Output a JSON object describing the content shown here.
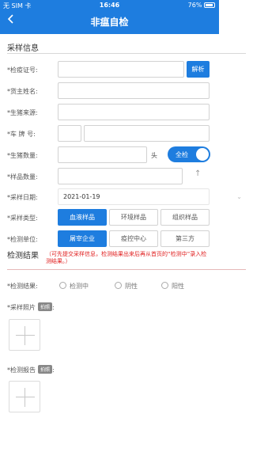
{
  "status_bar": {
    "carrier": "无 SIM 卡",
    "time": "16:46",
    "battery": "76%"
  },
  "header": {
    "title": "非瘟自检",
    "back_icon": "chevron-left-icon"
  },
  "sampling": {
    "section_title": "采样信息",
    "fields": {
      "quarantine_cert": {
        "label": "*检疫证号:",
        "value": "",
        "button": "解析"
      },
      "owner_name": {
        "label": "*货主姓名:",
        "value": ""
      },
      "pig_source": {
        "label": "*生猪来源:",
        "value": ""
      },
      "plate": {
        "label": "*车  牌  号:",
        "prefix": "",
        "value": ""
      },
      "pig_count": {
        "label": "*生猪数量:",
        "value": "",
        "unit": "头",
        "toggle_label": "全检",
        "toggle_on": true
      },
      "sample_count": {
        "label": "*样品数量:",
        "value": "",
        "arrow_icon": "arrow-up-icon"
      },
      "sample_date": {
        "label": "*采样日期:",
        "value": "2021-01-19",
        "dropdown_icon": "chevron-down-icon"
      },
      "sample_type": {
        "label": "*采样类型:",
        "options": [
          "血液样品",
          "环境样品",
          "组织样品"
        ],
        "selected": 0
      },
      "test_unit": {
        "label": "*检测单位:",
        "options": [
          "屠宰企业",
          "疫控中心",
          "第三方"
        ],
        "selected": 0
      }
    }
  },
  "result": {
    "section_title": "检测结果",
    "note": "（可先提交采样信息，检测结果出来后再从首页的“检测中”录入检测结果。）",
    "label": "*检测结果:",
    "options": [
      "检测中",
      "阴性",
      "阳性"
    ],
    "photo_label": "*采样照片",
    "photo_tag": "拍照",
    "report_label": "*检测报告",
    "report_tag": "拍照",
    "add_icon": "plus-icon"
  }
}
